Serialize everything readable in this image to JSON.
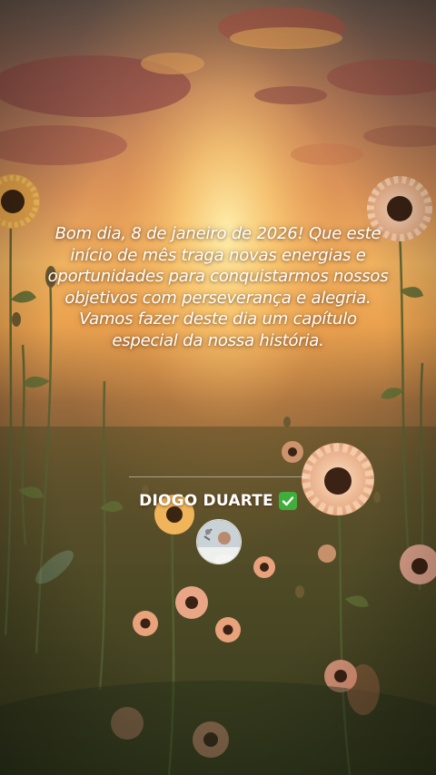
{
  "post": {
    "message": "Bom dia, 8 de janeiro de 2026! Que este início de mês traga novas energias e oportunidades para conquistarmos nossos objetivos com perseverança e alegria. Vamos fazer deste dia um capítulo especial da nossa história.",
    "author_name": "DIOGO DUARTE",
    "verified_icon": "check-mark-icon",
    "avatar_icon": "avatar-photo"
  },
  "colors": {
    "sky_top": "#6e5a4e",
    "sun_glow": "#ffd27a",
    "field": "#4b4a26",
    "verified_green": "#3fae3a",
    "text": "#ffffff"
  }
}
